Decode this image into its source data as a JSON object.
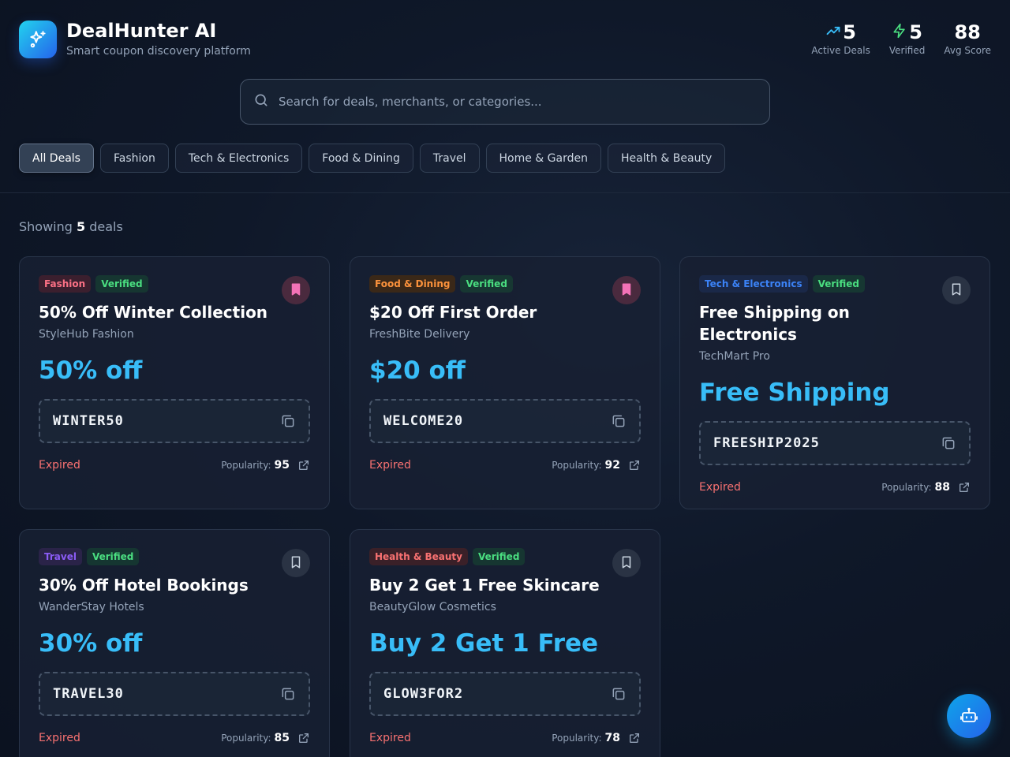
{
  "app": {
    "title": "DealHunter AI",
    "subtitle": "Smart coupon discovery platform",
    "accent": "#38bdf8"
  },
  "stats": [
    {
      "value": "5",
      "label": "Active Deals",
      "icon": "trending-up-icon",
      "color": "#38bdf8"
    },
    {
      "value": "5",
      "label": "Verified",
      "icon": "lightning-icon",
      "color": "#4ade80"
    },
    {
      "value": "88",
      "label": "Avg Score",
      "icon": "",
      "color": ""
    }
  ],
  "search": {
    "placeholder": "Search for deals, merchants, or categories...",
    "value": ""
  },
  "filters": [
    "All Deals",
    "Fashion",
    "Tech & Electronics",
    "Food & Dining",
    "Travel",
    "Home & Garden",
    "Health & Beauty"
  ],
  "active_filter": "All Deals",
  "results": {
    "prefix": "Showing",
    "count": "5",
    "suffix": "deals"
  },
  "labels": {
    "popularity": "Popularity:"
  },
  "deals": [
    {
      "category": "Fashion",
      "category_color": "#fb7185",
      "category_bg": "#3b1f2e",
      "verified": "Verified",
      "title": "50% Off Winter Collection",
      "merchant": "StyleHub Fashion",
      "discount": "50% off",
      "code": "WINTER50",
      "status": "Expired",
      "popularity": "95",
      "saved": true
    },
    {
      "category": "Food & Dining",
      "category_color": "#fb923c",
      "category_bg": "#3a2818",
      "verified": "Verified",
      "title": "$20 Off First Order",
      "merchant": "FreshBite Delivery",
      "discount": "$20 off",
      "code": "WELCOME20",
      "status": "Expired",
      "popularity": "92",
      "saved": true
    },
    {
      "category": "Tech & Electronics",
      "category_color": "#3b82f6",
      "category_bg": "#1a2848",
      "verified": "Verified",
      "title": "Free Shipping on Electronics",
      "merchant": "TechMart Pro",
      "discount": "Free Shipping",
      "code": "FREESHIP2025",
      "status": "Expired",
      "popularity": "88",
      "saved": false
    },
    {
      "category": "Travel",
      "category_color": "#8b5cf6",
      "category_bg": "#2a2348",
      "verified": "Verified",
      "title": "30% Off Hotel Bookings",
      "merchant": "WanderStay Hotels",
      "discount": "30% off",
      "code": "TRAVEL30",
      "status": "Expired",
      "popularity": "85",
      "saved": false
    },
    {
      "category": "Health & Beauty",
      "category_color": "#f87171",
      "category_bg": "#3a2028",
      "verified": "Verified",
      "title": "Buy 2 Get 1 Free Skincare",
      "merchant": "BeautyGlow Cosmetics",
      "discount": "Buy 2 Get 1 Free",
      "code": "GLOW3FOR2",
      "status": "Expired",
      "popularity": "78",
      "saved": false
    }
  ],
  "assistant": {
    "icon": "robot-icon"
  }
}
